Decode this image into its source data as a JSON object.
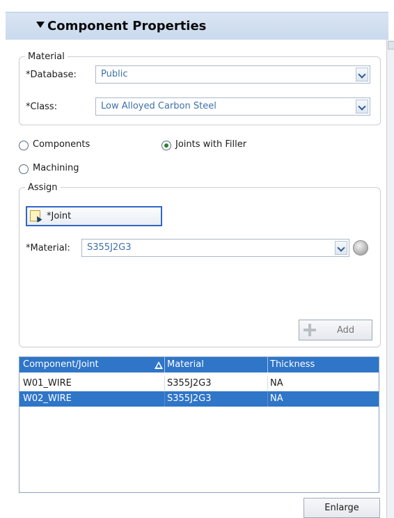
{
  "header": {
    "title": "Component Properties"
  },
  "material_group": {
    "legend": "Material",
    "database_label": "*Database:",
    "database_value": "Public",
    "class_label": "*Class:",
    "class_value": "Low Alloyed Carbon Steel"
  },
  "scope": {
    "options": [
      "Components",
      "Joints with Filler",
      "Machining"
    ],
    "selected": "Joints with Filler"
  },
  "assign_group": {
    "legend": "Assign",
    "joint_button": "*Joint",
    "material_label": "*Material:",
    "material_value": "S355J2G3",
    "add_button": "Add"
  },
  "table": {
    "columns": [
      "Component/Joint",
      "Material",
      "Thickness"
    ],
    "rows": [
      {
        "component": "W01_WIRE",
        "material": "S355J2G3",
        "thickness": "NA",
        "selected": false
      },
      {
        "component": "W02_WIRE",
        "material": "S355J2G3",
        "thickness": "NA",
        "selected": true
      }
    ]
  },
  "footer": {
    "enlarge_button": "Enlarge"
  },
  "colors": {
    "selection": "#2f75c8",
    "header_bg": "#d9e5f3",
    "value_text": "#3e6fa8"
  },
  "icons": [
    "triangle-down-icon",
    "chevron-down-icon",
    "joint-select-icon",
    "globe-icon",
    "plus-icon",
    "warning-icon"
  ]
}
